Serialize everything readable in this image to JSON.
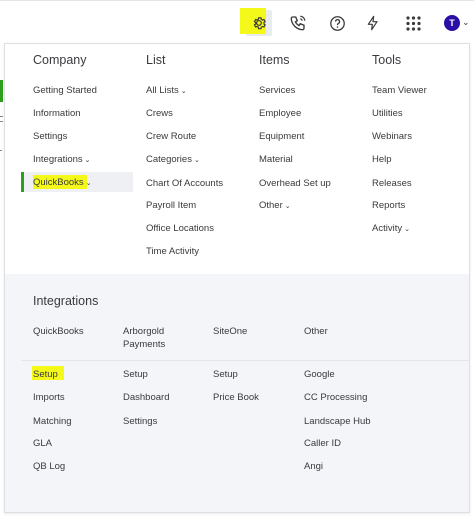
{
  "topbar": {
    "icons": [
      "gear-icon",
      "phone-icon",
      "help-icon",
      "lightning-icon",
      "apps-grid-icon"
    ],
    "avatar_initial": "T",
    "avatar_color": "#2c0fa6",
    "highlight_color": "#f4f91a"
  },
  "menu": {
    "columns": [
      {
        "title": "Company",
        "items": [
          "Getting Started",
          "Information",
          "Settings",
          "Integrations",
          "QuickBooks"
        ]
      },
      {
        "title": "List",
        "items": [
          "All Lists",
          "Crews",
          "Crew Route",
          "Categories",
          "Chart Of Accounts",
          "Payroll Item",
          "Office Locations",
          "Time Activity"
        ]
      },
      {
        "title": "Items",
        "items": [
          "Services",
          "Employee",
          "Equipment",
          "Material",
          "Overhead Set up",
          "Other"
        ]
      },
      {
        "title": "Tools",
        "items": [
          "Team Viewer",
          "Utilities",
          "Webinars",
          "Help",
          "Releases",
          "Reports",
          "Activity"
        ]
      }
    ]
  },
  "integrations": {
    "title": "Integrations",
    "columns": [
      {
        "title": "QuickBooks",
        "items": [
          "Setup",
          "Imports",
          "Matching",
          "GLA",
          "QB Log"
        ]
      },
      {
        "title": "Arborgold Payments",
        "items": [
          "Setup",
          "Dashboard",
          "Settings"
        ]
      },
      {
        "title": "SiteOne",
        "items": [
          "Setup",
          "Price Book"
        ]
      },
      {
        "title": "Other",
        "items": [
          "Google",
          "CC Processing",
          "Landscape Hub",
          "Caller ID",
          "Angi"
        ]
      }
    ]
  },
  "colors": {
    "accent_green": "#2ca01c",
    "highlight_yellow": "#f4f91a",
    "integrations_bg": "#f4f5f8"
  }
}
